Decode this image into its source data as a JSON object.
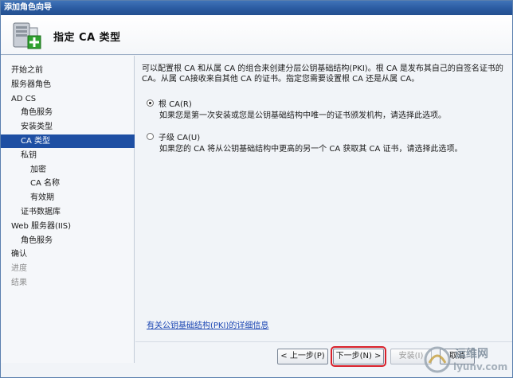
{
  "window": {
    "title": "添加角色向导"
  },
  "header": {
    "title": "指定 CA 类型"
  },
  "sidebar": {
    "items": [
      {
        "label": "开始之前",
        "level": 0,
        "state": "normal"
      },
      {
        "label": "服务器角色",
        "level": 0,
        "state": "normal"
      },
      {
        "label": "AD CS",
        "level": 0,
        "state": "normal"
      },
      {
        "label": "角色服务",
        "level": 1,
        "state": "normal"
      },
      {
        "label": "安装类型",
        "level": 1,
        "state": "normal"
      },
      {
        "label": "CA 类型",
        "level": 1,
        "state": "selected"
      },
      {
        "label": "私钥",
        "level": 1,
        "state": "normal"
      },
      {
        "label": "加密",
        "level": 2,
        "state": "normal"
      },
      {
        "label": "CA 名称",
        "level": 2,
        "state": "normal"
      },
      {
        "label": "有效期",
        "level": 2,
        "state": "normal"
      },
      {
        "label": "证书数据库",
        "level": 1,
        "state": "normal"
      },
      {
        "label": "Web 服务器(IIS)",
        "level": 0,
        "state": "normal"
      },
      {
        "label": "角色服务",
        "level": 1,
        "state": "normal"
      },
      {
        "label": "确认",
        "level": 0,
        "state": "normal"
      },
      {
        "label": "进度",
        "level": 0,
        "state": "disabled"
      },
      {
        "label": "结果",
        "level": 0,
        "state": "disabled"
      }
    ]
  },
  "content": {
    "intro": "可以配置根 CA 和从属 CA 的组合来创建分层公钥基础结构(PKI)。根 CA 是发布其自己的自签名证书的 CA。从属 CA接收来自其他 CA 的证书。指定您需要设置根 CA 还是从属 CA。",
    "options": [
      {
        "label": "根 CA(R)",
        "description": "如果您是第一次安装或您是公钥基础结构中唯一的证书颁发机构，请选择此选项。",
        "checked": true
      },
      {
        "label": "子级 CA(U)",
        "description": "如果您的 CA 将从公钥基础结构中更高的另一个 CA 获取其 CA 证书，请选择此选项。",
        "checked": false
      }
    ],
    "more_link": "有关公钥基础结构(PKI)的详细信息"
  },
  "footer": {
    "prev_label": "< 上一步(P)",
    "next_label": "下一步(N) >",
    "install_label": "安装(I)",
    "cancel_label": "取消"
  },
  "watermark": {
    "line1": "运维网",
    "line2": "iyunv.com"
  }
}
